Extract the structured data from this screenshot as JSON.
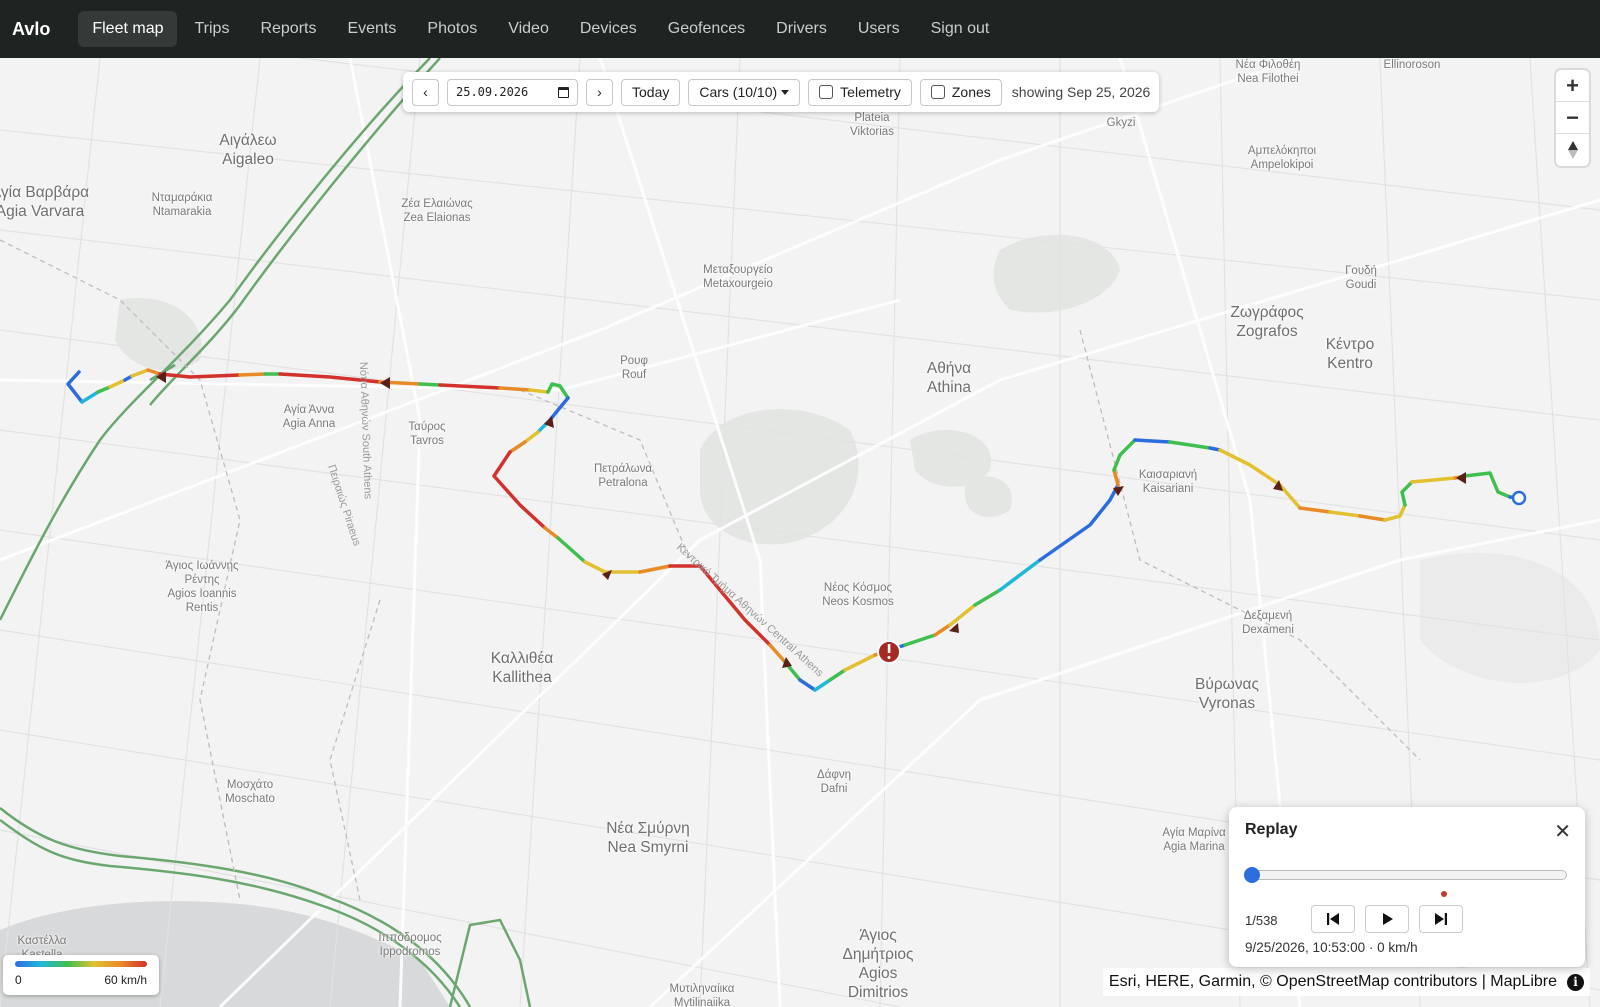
{
  "brand": "Avlo",
  "nav": [
    {
      "label": "Fleet map",
      "active": true
    },
    {
      "label": "Trips"
    },
    {
      "label": "Reports"
    },
    {
      "label": "Events"
    },
    {
      "label": "Photos"
    },
    {
      "label": "Video"
    },
    {
      "label": "Devices"
    },
    {
      "label": "Geofences"
    },
    {
      "label": "Drivers"
    },
    {
      "label": "Users"
    },
    {
      "label": "Sign out"
    }
  ],
  "toolbar": {
    "prev": "‹",
    "next": "›",
    "date_value": "25.09.2026",
    "today": "Today",
    "cars": "Cars (10/10)",
    "telemetry": "Telemetry",
    "zones": "Zones",
    "showing": "showing Sep 25, 2026"
  },
  "zoom": {
    "in": "+",
    "out": "−"
  },
  "legend": {
    "min": "0",
    "max": "60 km/h"
  },
  "attribution": "Esri, HERE, Garmin, © OpenStreetMap contributors | MapLibre",
  "info_icon": "i",
  "replay": {
    "title": "Replay",
    "counter": "1/538",
    "timestamp": "9/25/2026, 10:53:00 · 0 km/h",
    "progress": 0
  },
  "places": [
    {
      "id": "nea-filothei",
      "l1": "Νέα Φιλοθέη",
      "l2": "Nea Filothei"
    },
    {
      "id": "ellinoroson",
      "l1": "Ellinoroson",
      "l2": ""
    },
    {
      "id": "plateia",
      "l1": "Plateia",
      "l2": "Viktorias"
    },
    {
      "id": "gkyzi",
      "l1": "Gkyzi",
      "l2": ""
    },
    {
      "id": "aigaleo",
      "l1": "Αιγάλεω",
      "l2": "Aigaleo"
    },
    {
      "id": "agia-varvara",
      "l1": "Αγία Βαρβάρα",
      "l2": "Agia Varvara"
    },
    {
      "id": "ntamarakia",
      "l1": "Νταμαράκια",
      "l2": "Ntamarakia"
    },
    {
      "id": "zea",
      "l1": "Ζέα Ελαιώνας",
      "l2": "Zea Elaionas"
    },
    {
      "id": "ampelokipoi",
      "l1": "Αμπελόκηποι",
      "l2": "Ampelokipoi"
    },
    {
      "id": "metaxourgeio",
      "l1": "Μεταξουργείο",
      "l2": "Metaxourgeio"
    },
    {
      "id": "goudi",
      "l1": "Γουδή",
      "l2": "Goudi"
    },
    {
      "id": "zografos",
      "l1": "Ζωγράφος",
      "l2": "Zografos"
    },
    {
      "id": "kentro",
      "l1": "Κέντρο",
      "l2": "Kentro"
    },
    {
      "id": "rouf",
      "l1": "Ρουφ",
      "l2": "Rouf"
    },
    {
      "id": "athina",
      "l1": "Αθήνα",
      "l2": "Athina"
    },
    {
      "id": "agia-anna",
      "l1": "Αγία Άννα",
      "l2": "Agia Anna"
    },
    {
      "id": "tavros",
      "l1": "Ταύρος",
      "l2": "Tavros"
    },
    {
      "id": "petralona",
      "l1": "Πετράλωνα",
      "l2": "Petralona"
    },
    {
      "id": "kaisariani",
      "l1": "Καισαριανή",
      "l2": "Kaisariani"
    },
    {
      "id": "agios-ioannis",
      "l1": "Άγιος Ιωάννης",
      "l2": "Ρέντης",
      "l3": "Agios Ioannis",
      "l4": "Rentis"
    },
    {
      "id": "neos-kosmos",
      "l1": "Νέος Κόσμος",
      "l2": "Neos Kosmos"
    },
    {
      "id": "dexameni",
      "l1": "Δεξαμενή",
      "l2": "Dexameni"
    },
    {
      "id": "kallithea",
      "l1": "Καλλιθέα",
      "l2": "Kallithea"
    },
    {
      "id": "vyronas",
      "l1": "Βύρωνας",
      "l2": "Vyronas"
    },
    {
      "id": "moschato",
      "l1": "Μοσχάτο",
      "l2": "Moschato"
    },
    {
      "id": "dafni",
      "l1": "Δάφνη",
      "l2": "Dafni"
    },
    {
      "id": "nea-smyrni",
      "l1": "Νέα Σμύρνη",
      "l2": "Nea Smyrni"
    },
    {
      "id": "agia-marina",
      "l1": "Αγία Μαρίνα",
      "l2": "Agia Marina"
    },
    {
      "id": "kastella",
      "l1": "Καστέλλα",
      "l2": "Kastella"
    },
    {
      "id": "ippodromos",
      "l1": "Ιππόδρομος",
      "l2": "Ippodromos"
    },
    {
      "id": "agios-dimitrios",
      "l1": "Άγιος",
      "l2": "Δημήτριος",
      "l3": "Agios",
      "l4": "Dimitrios"
    },
    {
      "id": "mytilinaiika",
      "l1": "Μυτιληναίικα",
      "l2": "Mytilinaiika"
    }
  ],
  "street_labels": {
    "pireos": "Πειραιώς Piraeus",
    "athinon": "Νότια Αθηνών South Athens",
    "kentriki": "Κεντρικό Τμήμα Αθηνών Central Athens"
  }
}
